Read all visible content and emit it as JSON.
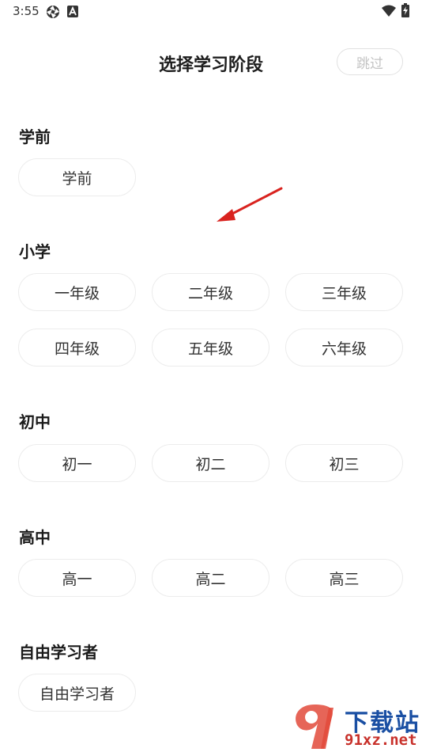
{
  "status_bar": {
    "time": "3:55",
    "icons": [
      "aperture-icon",
      "a-app-icon",
      "wifi-icon",
      "battery-charging-icon"
    ]
  },
  "header": {
    "title": "选择学习阶段",
    "skip_label": "跳过"
  },
  "sections": [
    {
      "title": "学前",
      "options": [
        "学前"
      ]
    },
    {
      "title": "小学",
      "options": [
        "一年级",
        "二年级",
        "三年级",
        "四年级",
        "五年级",
        "六年级"
      ]
    },
    {
      "title": "初中",
      "options": [
        "初一",
        "初二",
        "初三"
      ]
    },
    {
      "title": "高中",
      "options": [
        "高一",
        "高二",
        "高三"
      ]
    },
    {
      "title": "自由学习者",
      "options": [
        "自由学习者"
      ]
    }
  ],
  "annotation": {
    "icon": "red-arrow-icon",
    "color": "#d9231f"
  },
  "watermark": {
    "name": "下载站",
    "domain": "91xz.net",
    "colors": {
      "brand_blue": "#1a4fa3",
      "brand_red": "#c8312b"
    }
  }
}
